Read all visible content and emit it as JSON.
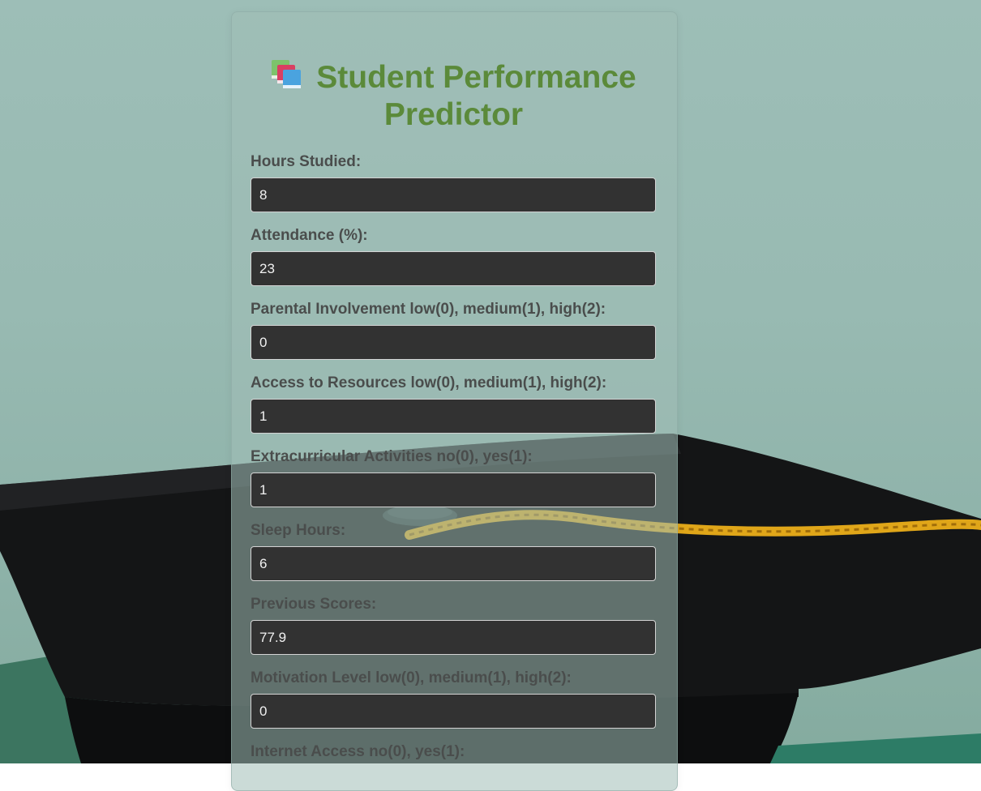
{
  "header": {
    "title_line1": "Student Performance",
    "title_line2": "Predictor",
    "icon": "books-icon"
  },
  "form": {
    "fields": [
      {
        "label": "Hours Studied:",
        "value": "8"
      },
      {
        "label": "Attendance (%):",
        "value": "23"
      },
      {
        "label": "Parental Involvement low(0), medium(1), high(2):",
        "value": "0"
      },
      {
        "label": "Access to Resources low(0), medium(1), high(2):",
        "value": "1"
      },
      {
        "label": "Extracurricular Activities no(0), yes(1):",
        "value": "1"
      },
      {
        "label": "Sleep Hours:",
        "value": "6"
      },
      {
        "label": "Previous Scores:",
        "value": "77.9"
      },
      {
        "label": "Motivation Level low(0), medium(1), high(2):",
        "value": "0"
      },
      {
        "label": "Internet Access no(0), yes(1):",
        "value": ""
      }
    ]
  },
  "colors": {
    "title": "#5b8a3a",
    "label": "#4a4d4c",
    "input_bg": "#323232",
    "input_border": "#d4d4d4",
    "input_text": "#f1f1f1",
    "background": "#9dbeb7"
  }
}
